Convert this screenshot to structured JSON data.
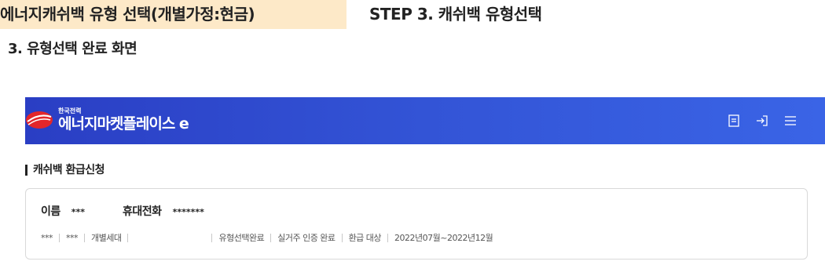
{
  "doc": {
    "title": "에너지캐쉬백 유형 선택(개별가정:현금)",
    "step": "STEP 3. 캐쉬백 유형선택",
    "subtitle": "3. 유형선택 완료 화면"
  },
  "header": {
    "logo_small": "한국전력",
    "logo_main": "에너지마켓플레이스 e",
    "icons": [
      "document-icon",
      "login-icon",
      "menu-icon"
    ]
  },
  "section": {
    "title": "캐쉬백 환급신청"
  },
  "card": {
    "name_label": "이름",
    "name_value": "***",
    "phone_label": "휴대전화",
    "phone_value": "*******",
    "info": [
      "***",
      "***",
      "개별세대",
      "",
      "유형선택완료",
      "실거주 인증 완료",
      "환급 대상",
      "2022년07월~2022년12월"
    ]
  },
  "colors": {
    "header_start": "#2a3ec4",
    "header_end": "#3a64e6",
    "title_highlight": "#fde9c8",
    "logo_red": "#e3262b"
  }
}
